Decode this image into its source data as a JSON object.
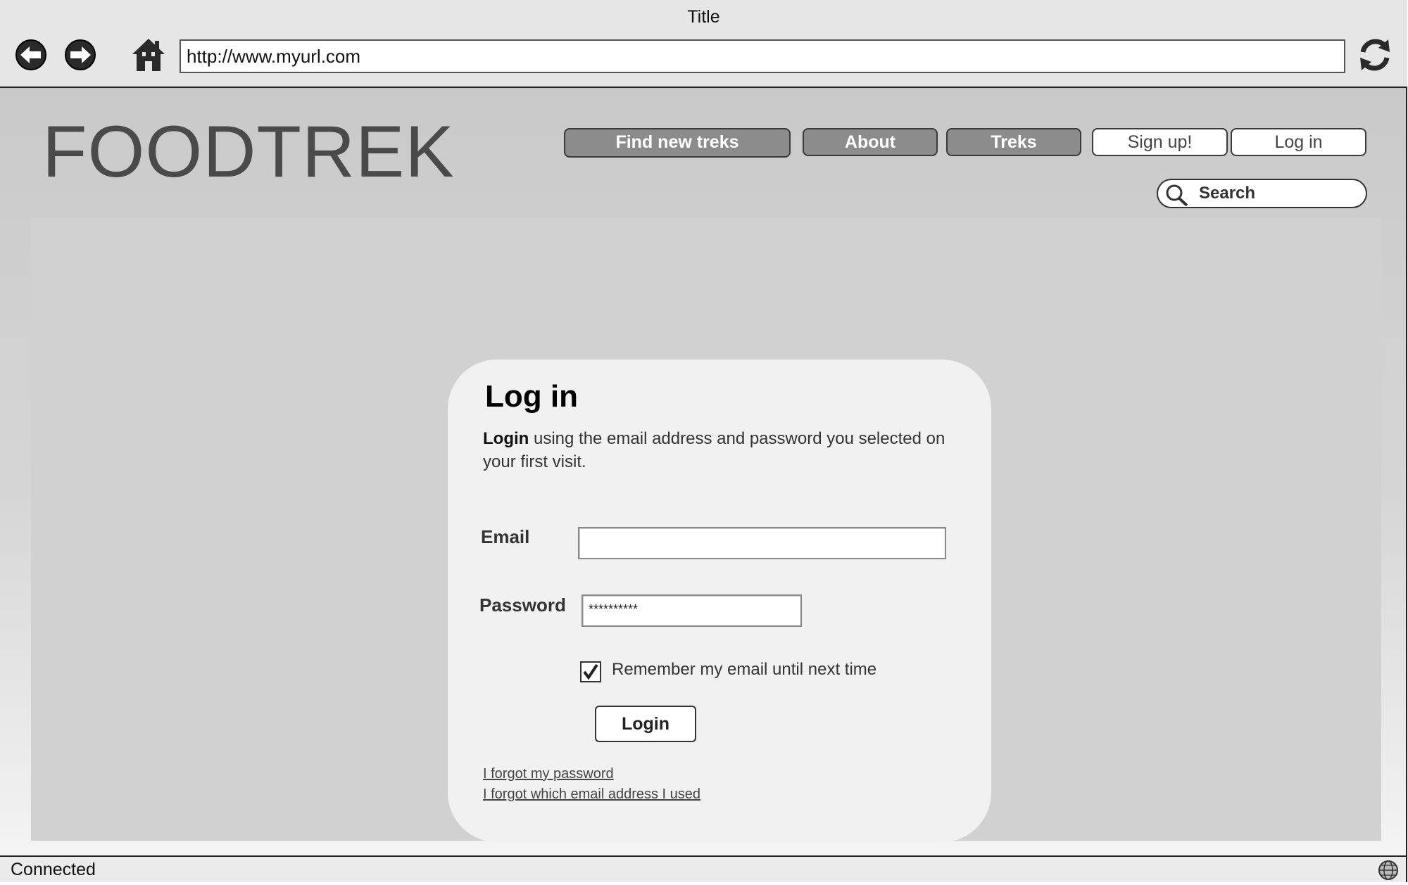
{
  "window": {
    "title": "Title"
  },
  "browser": {
    "url": "http://www.myurl.com",
    "icons": {
      "back": "arrow-left-circle",
      "forward": "arrow-right-circle",
      "home": "house",
      "refresh": "circular-arrows"
    }
  },
  "site": {
    "logo": "FOODTREK",
    "nav": [
      {
        "label": "Find new treks"
      },
      {
        "label": "About"
      },
      {
        "label": "Treks"
      },
      {
        "label": "Sign up!"
      },
      {
        "label": "Log in"
      }
    ],
    "search_label": "Search"
  },
  "login": {
    "title": "Log in",
    "desc_bold": "Login",
    "desc_rest": " using the email address and password you selected on your first visit.",
    "email_label": "Email",
    "email_value": "",
    "password_label": "Password",
    "password_value": "**********",
    "remember_label": "Remember my email until next time",
    "remember_checked": true,
    "submit_label": "Login",
    "forgot_password": "I forgot my password",
    "forgot_email": "I forgot which email address I used"
  },
  "status": {
    "text": "Connected",
    "icon": "globe"
  },
  "colors": {
    "chrome_bg": "#e6e6e6",
    "page_bg": "#d1d1d1",
    "card_bg": "#f1f1f1",
    "nav_dark": "#8c8c8c",
    "logo": "#4a4a4a"
  }
}
